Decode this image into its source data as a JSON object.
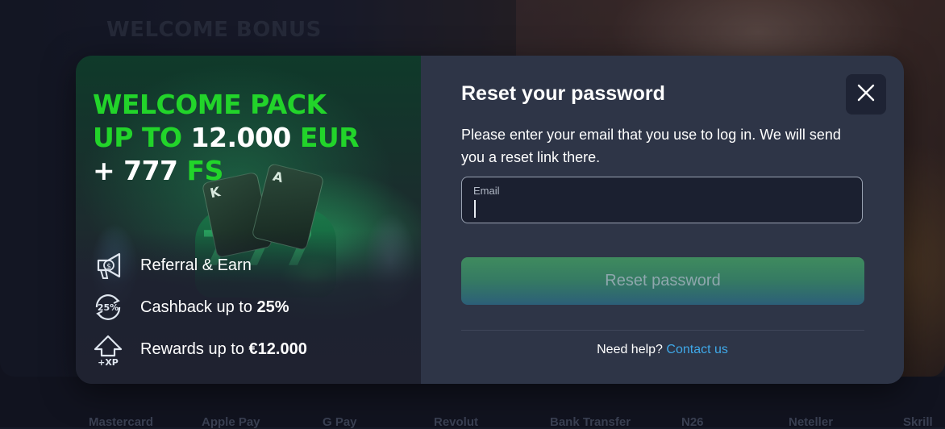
{
  "background": {
    "section_title": "WELCOME BONUS",
    "payment_logos": [
      "Mastercard",
      "Apple Pay",
      "G Pay",
      "Revolut",
      "Bank Transfer",
      "N26",
      "Neteller",
      "Skrill"
    ]
  },
  "promo": {
    "headline_line1": "WELCOME PACK",
    "headline_line2_prefix": "UP TO ",
    "headline_line2_amount": "12.000",
    "headline_line2_suffix": " EUR",
    "headline_line3_prefix": "+ 777",
    "headline_line3_suffix": " FS",
    "features": [
      {
        "icon": "megaphone-icon",
        "text": "Referral & Earn",
        "bold": ""
      },
      {
        "icon": "cashback-25-icon",
        "text": "Cashback up to ",
        "bold": "25%"
      },
      {
        "icon": "xp-arrow-icon",
        "text": "Rewards up to ",
        "bold": "€12.000"
      }
    ],
    "art": {
      "card_king": "K",
      "card_ace": "A",
      "sevens": "7 7 7"
    },
    "colors": {
      "accent_green": "#22d42a"
    }
  },
  "form": {
    "title": "Reset your password",
    "description": "Please enter your email that you use to log in. We will send you a reset link there.",
    "email_label": "Email",
    "email_value": "",
    "submit_label": "Reset password",
    "help_text": "Need help?",
    "help_link": "Contact us",
    "close_icon": "close-icon",
    "colors": {
      "link": "#3fa8e8",
      "panel_bg": "#2e3547"
    }
  }
}
